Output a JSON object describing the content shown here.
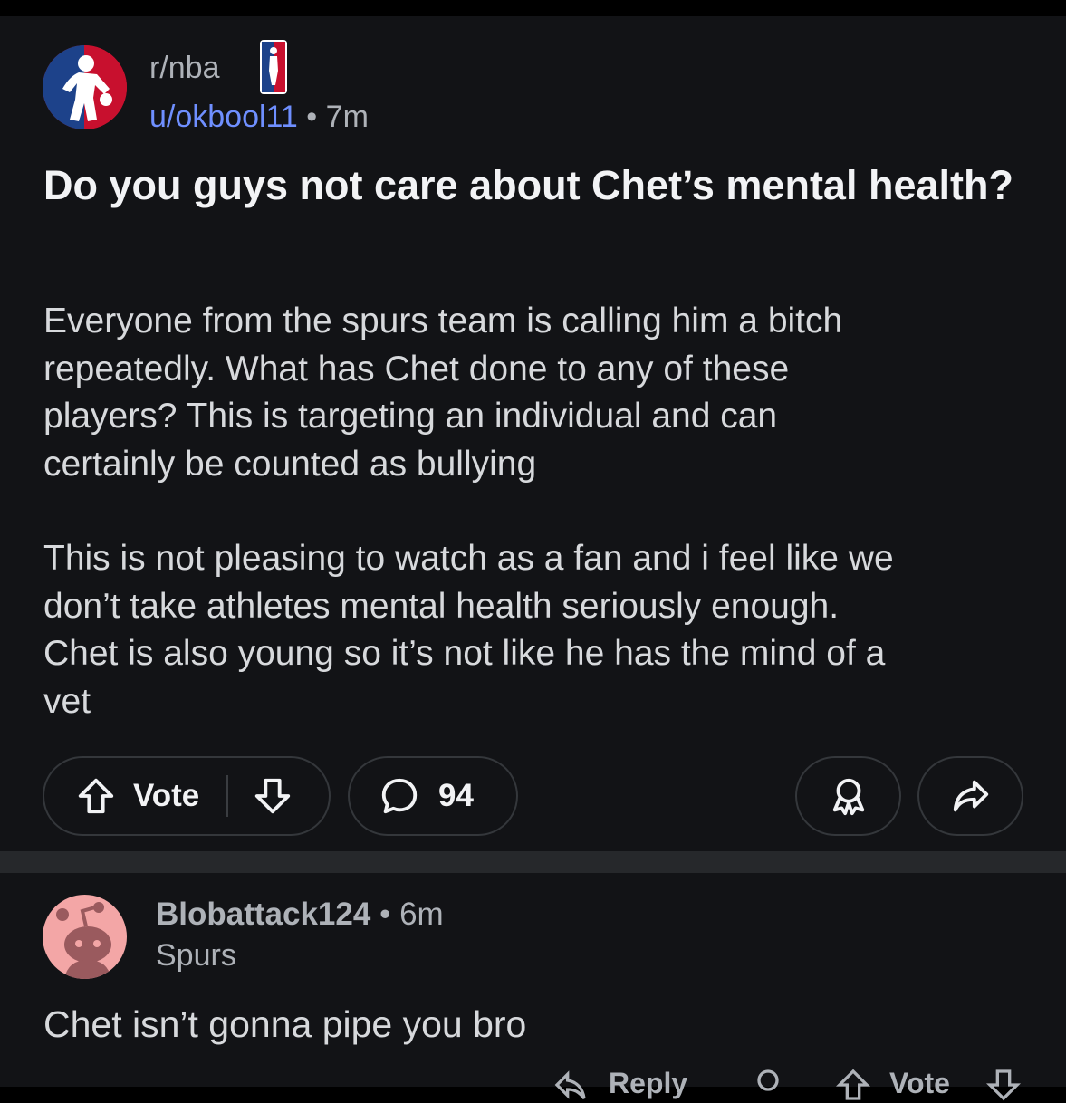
{
  "post": {
    "subreddit": "r/nba",
    "author": "u/okbool11",
    "separator": "•",
    "age": "7m",
    "title": "Do you guys not care about Chet’s mental health?",
    "paragraphs": [
      [
        "Everyone from the spurs team is calling him a bitch",
        "repeatedly. What has Chet done to any of these",
        "players? This is targeting an individual and can",
        "certainly be counted as bullying"
      ],
      [
        "This is not pleasing to watch as a fan and i feel like we",
        "don’t take athletes mental health seriously enough.",
        "Chet is also young so it’s not like he has the mind of a",
        "vet"
      ]
    ]
  },
  "actions": {
    "vote_label": "Vote",
    "comment_count": "94",
    "icons": [
      "upvote-icon",
      "downvote-icon",
      "comment-icon",
      "award-icon",
      "share-icon"
    ]
  },
  "comment": {
    "username": "Blobattack124",
    "separator": "•",
    "age": "6m",
    "flair": "Spurs",
    "text": "Chet isn’t gonna pipe you bro"
  },
  "comment_actions": {
    "reply_label": "Reply",
    "vote_label": "Vote"
  },
  "colors": {
    "background": "#121316",
    "author_link": "#6f8fff",
    "muted_text": "#aeb2b8",
    "nba_red": "#c8102e",
    "nba_blue": "#1d428a",
    "comment_avatar": "#f3a6a6"
  }
}
